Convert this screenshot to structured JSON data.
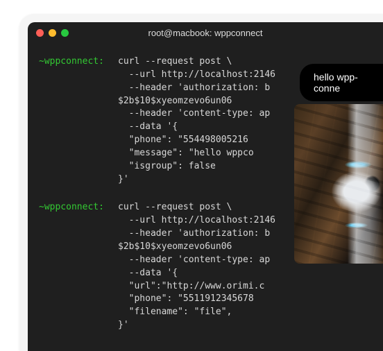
{
  "titlebar": {
    "title": "root@macbook: wppconnect"
  },
  "prompt": "~wppconnect:",
  "commands": [
    "curl --request post \\\n  --url http://localhost:2146\n  --header 'authorization: b\n$2b$10$xyeomzevo6un06\n  --header 'content-type: ap\n  --data '{\n  \"phone\": \"554498005216\n  \"message\": \"hello wppco\n  \"isgroup\": false\n}'",
    "curl --request post \\\n  --url http://localhost:2146\n  --header 'authorization: b\n$2b$10$xyeomzevo6un06\n  --header 'content-type: ap\n  --data '{\n  \"url\":\"http://www.orimi.c\n  \"phone\": \"5511912345678\n  \"filename\": \"file\",\n}'"
  ],
  "bubble": {
    "text": "hello wpp-conne"
  },
  "image": {
    "alt": "robot-photo"
  }
}
